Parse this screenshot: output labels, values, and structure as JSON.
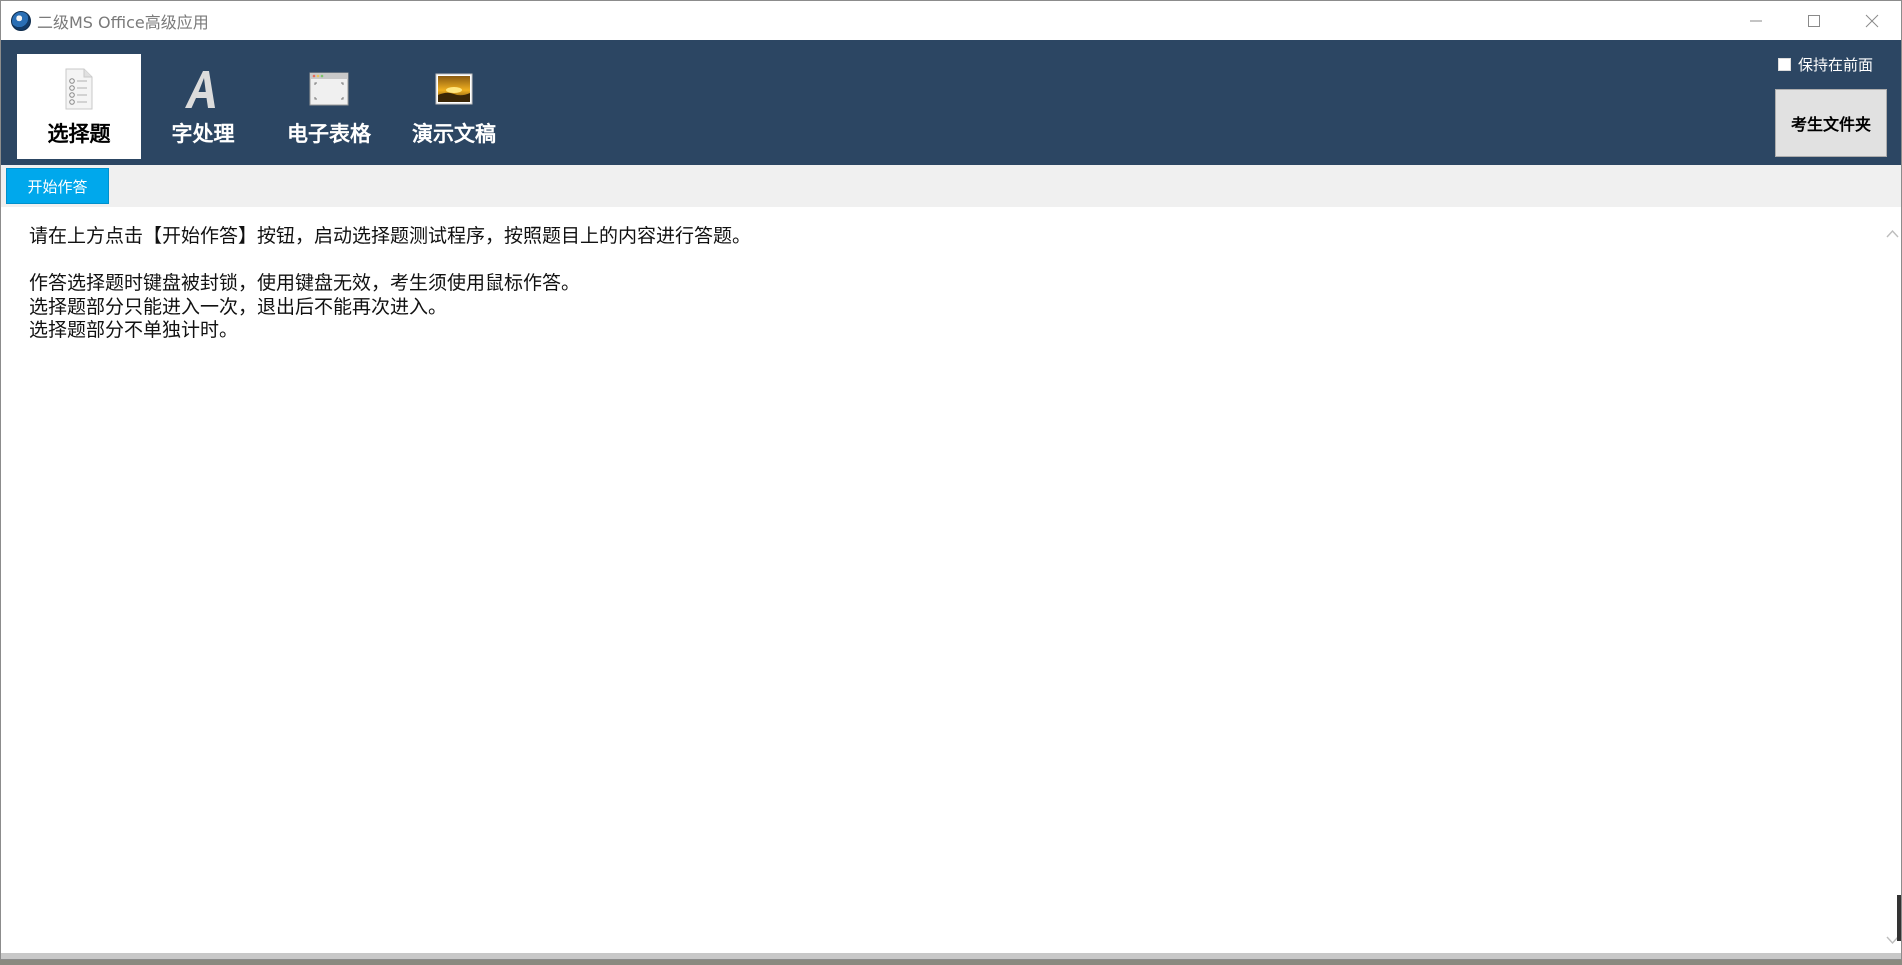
{
  "window": {
    "title": "二级MS Office高级应用"
  },
  "ribbon": {
    "tabs": [
      {
        "label": "选择题",
        "icon": "choice-list-icon",
        "active": true
      },
      {
        "label": "字处理",
        "icon": "letter-a-icon",
        "active": false
      },
      {
        "label": "电子表格",
        "icon": "spreadsheet-window-icon",
        "active": false
      },
      {
        "label": "演示文稿",
        "icon": "presentation-image-icon",
        "active": false
      }
    ],
    "keep_front_label": "保持在前面",
    "keep_front_checked": false,
    "folder_button_label": "考生文件夹"
  },
  "toolbar": {
    "start_label": "开始作答"
  },
  "content": {
    "lines": [
      "请在上方点击【开始作答】按钮，启动选择题测试程序，按照题目上的内容进行答题。",
      "",
      "作答选择题时键盘被封锁，使用键盘无效，考生须使用鼠标作答。",
      "选择题部分只能进入一次，退出后不能再次进入。",
      "选择题部分不单独计时。"
    ]
  },
  "colors": {
    "ribbon_bg": "#2c4663",
    "start_button": "#00a8ec",
    "toolbar_bg": "#f0f0f0"
  }
}
